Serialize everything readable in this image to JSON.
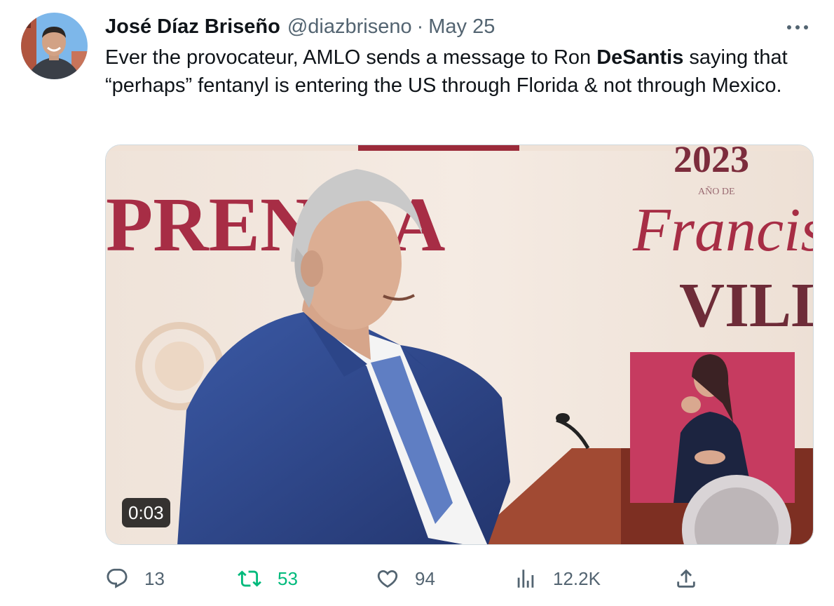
{
  "tweet": {
    "author_name": "José Díaz Briseño",
    "handle": "@diazbriseno",
    "separator": "·",
    "date": "May 25",
    "text_part1": "Ever the provocateur, AMLO sends a message to Ron ",
    "text_bold": "DeSantis",
    "text_part2": " saying that “perhaps” fentanyl is entering the US through Florida & not through Mexico."
  },
  "media": {
    "duration": "0:03"
  },
  "actions": {
    "replies": "13",
    "retweets": "53",
    "likes": "94",
    "views": "12.2K"
  },
  "colors": {
    "text": "#0f1419",
    "secondary": "#536471",
    "retweet_active": "#00ba7c"
  },
  "icons": [
    "more-icon",
    "reply-icon",
    "retweet-icon",
    "like-icon",
    "views-icon",
    "share-icon"
  ]
}
